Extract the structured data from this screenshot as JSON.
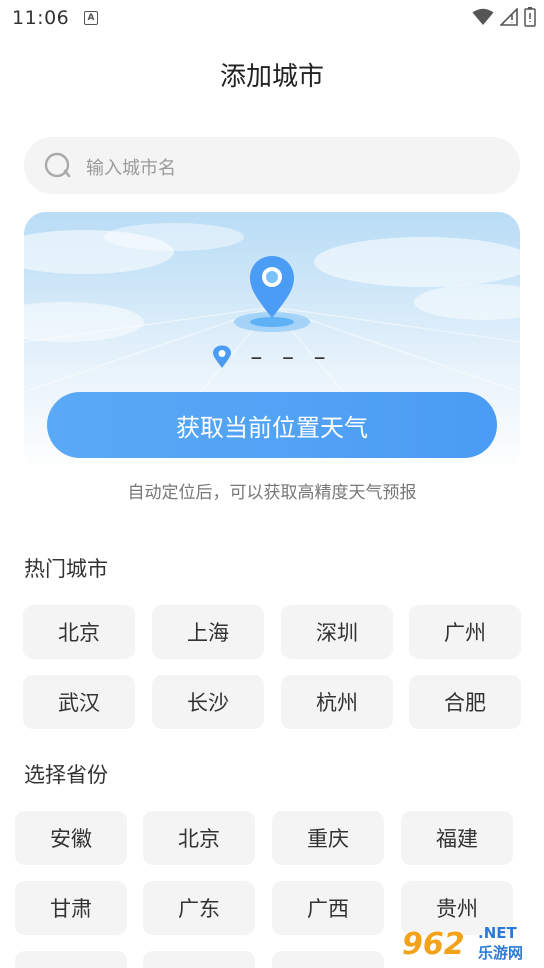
{
  "status_bar": {
    "time": "11:06",
    "notification_letter": "A"
  },
  "page": {
    "title": "添加城市"
  },
  "search": {
    "placeholder": "输入城市名"
  },
  "location_card": {
    "current_location": "– – –",
    "button_label": "获取当前位置天气",
    "hint": "自动定位后，可以获取高精度天气预报"
  },
  "hot_cities": {
    "title": "热门城市",
    "items": [
      "北京",
      "上海",
      "深圳",
      "广州",
      "武汉",
      "长沙",
      "杭州",
      "合肥"
    ]
  },
  "provinces": {
    "title": "选择省份",
    "items": [
      "安徽",
      "北京",
      "重庆",
      "福建",
      "甘肃",
      "广东",
      "广西",
      "贵州"
    ]
  },
  "watermark": {
    "number": "962",
    "suffix": ".NET",
    "text": "乐游网"
  },
  "colors": {
    "accent": "#4a9cf4",
    "chip_bg": "#f4f4f5",
    "hint": "#777777"
  }
}
